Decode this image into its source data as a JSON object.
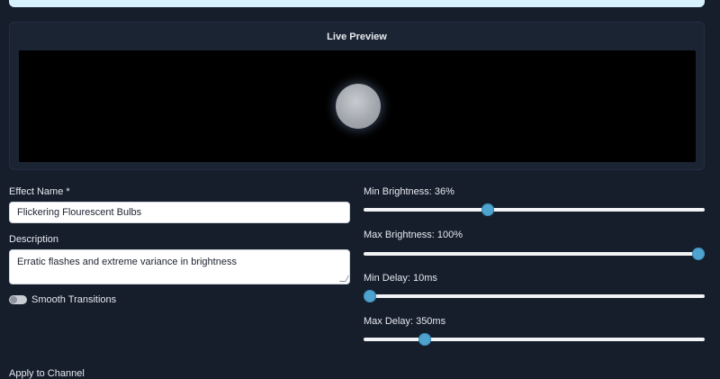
{
  "preview": {
    "title": "Live Preview"
  },
  "form": {
    "effect_name_label": "Effect Name *",
    "effect_name_value": "Flickering Flourescent Bulbs",
    "description_label": "Description",
    "description_value": "Erratic flashes and extreme variance in brightness",
    "smooth_transitions_label": "Smooth Transitions",
    "smooth_transitions_on": false,
    "apply_channel_label": "Apply to Channel"
  },
  "sliders": [
    {
      "label": "Min Brightness: 36%",
      "fraction": 0.365
    },
    {
      "label": "Max Brightness: 100%",
      "fraction": 1.0
    },
    {
      "label": "Min Delay: 10ms",
      "fraction": 0.015
    },
    {
      "label": "Max Delay: 350ms",
      "fraction": 0.18
    }
  ],
  "colors": {
    "background": "#161e2c",
    "accent": "#4fa3cf",
    "banner": "#d6f1fb"
  }
}
